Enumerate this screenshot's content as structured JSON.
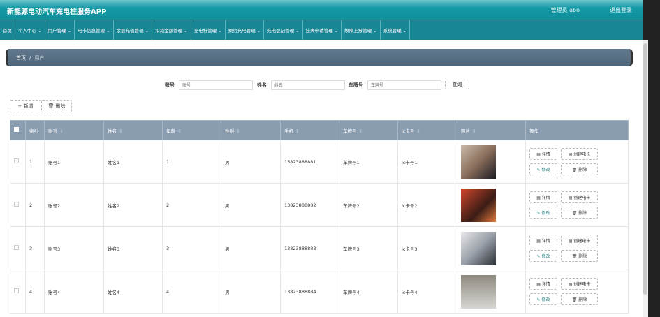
{
  "header": {
    "title": "新能源电动汽车充电桩服务APP",
    "user": "管理员 abo",
    "logout": "退出登录"
  },
  "nav": [
    "首页",
    "个人中心 ⌄",
    "用户管理 ⌄",
    "电卡信息管理 ⌄",
    "余额充值管理 ⌄",
    "扣减金额管理 ⌄",
    "充电桩管理 ⌄",
    "预约充电管理 ⌄",
    "充电登记管理 ⌄",
    "挂失申请管理 ⌄",
    "故障上报管理 ⌄",
    "系统管理 ⌄"
  ],
  "breadcrumb": {
    "home": "首页",
    "sep": "/",
    "current": "用户"
  },
  "search": {
    "account_label": "账号",
    "account_placeholder": "账号",
    "name_label": "姓名",
    "name_placeholder": "姓名",
    "plate_label": "车牌号",
    "plate_placeholder": "车牌号",
    "query": "查询"
  },
  "actions": {
    "add": "+ 新增",
    "delete": "🗑 删除"
  },
  "table": {
    "headers": [
      "索引",
      "账号",
      "姓名",
      "年龄",
      "性别",
      "手机",
      "车牌号",
      "ic卡号",
      "照片",
      "操作"
    ],
    "rows": [
      {
        "idx": "1",
        "account": "账号1",
        "name": "姓名1",
        "age": "1",
        "gender": "男",
        "phone": "13823888881",
        "plate": "车牌号1",
        "ic": "ic卡号1"
      },
      {
        "idx": "2",
        "account": "账号2",
        "name": "姓名2",
        "age": "2",
        "gender": "男",
        "phone": "13823888882",
        "plate": "车牌号2",
        "ic": "ic卡号2"
      },
      {
        "idx": "3",
        "account": "账号3",
        "name": "姓名3",
        "age": "3",
        "gender": "男",
        "phone": "13823888883",
        "plate": "车牌号3",
        "ic": "ic卡号3"
      },
      {
        "idx": "4",
        "account": "账号4",
        "name": "姓名4",
        "age": "4",
        "gender": "男",
        "phone": "13823888884",
        "plate": "车牌号4",
        "ic": "ic卡号4"
      }
    ],
    "ops": {
      "detail": "▤ 详情",
      "create_card": "▤ 创建电卡",
      "edit": "✎ 修改",
      "delete": "🗑 删除"
    }
  }
}
